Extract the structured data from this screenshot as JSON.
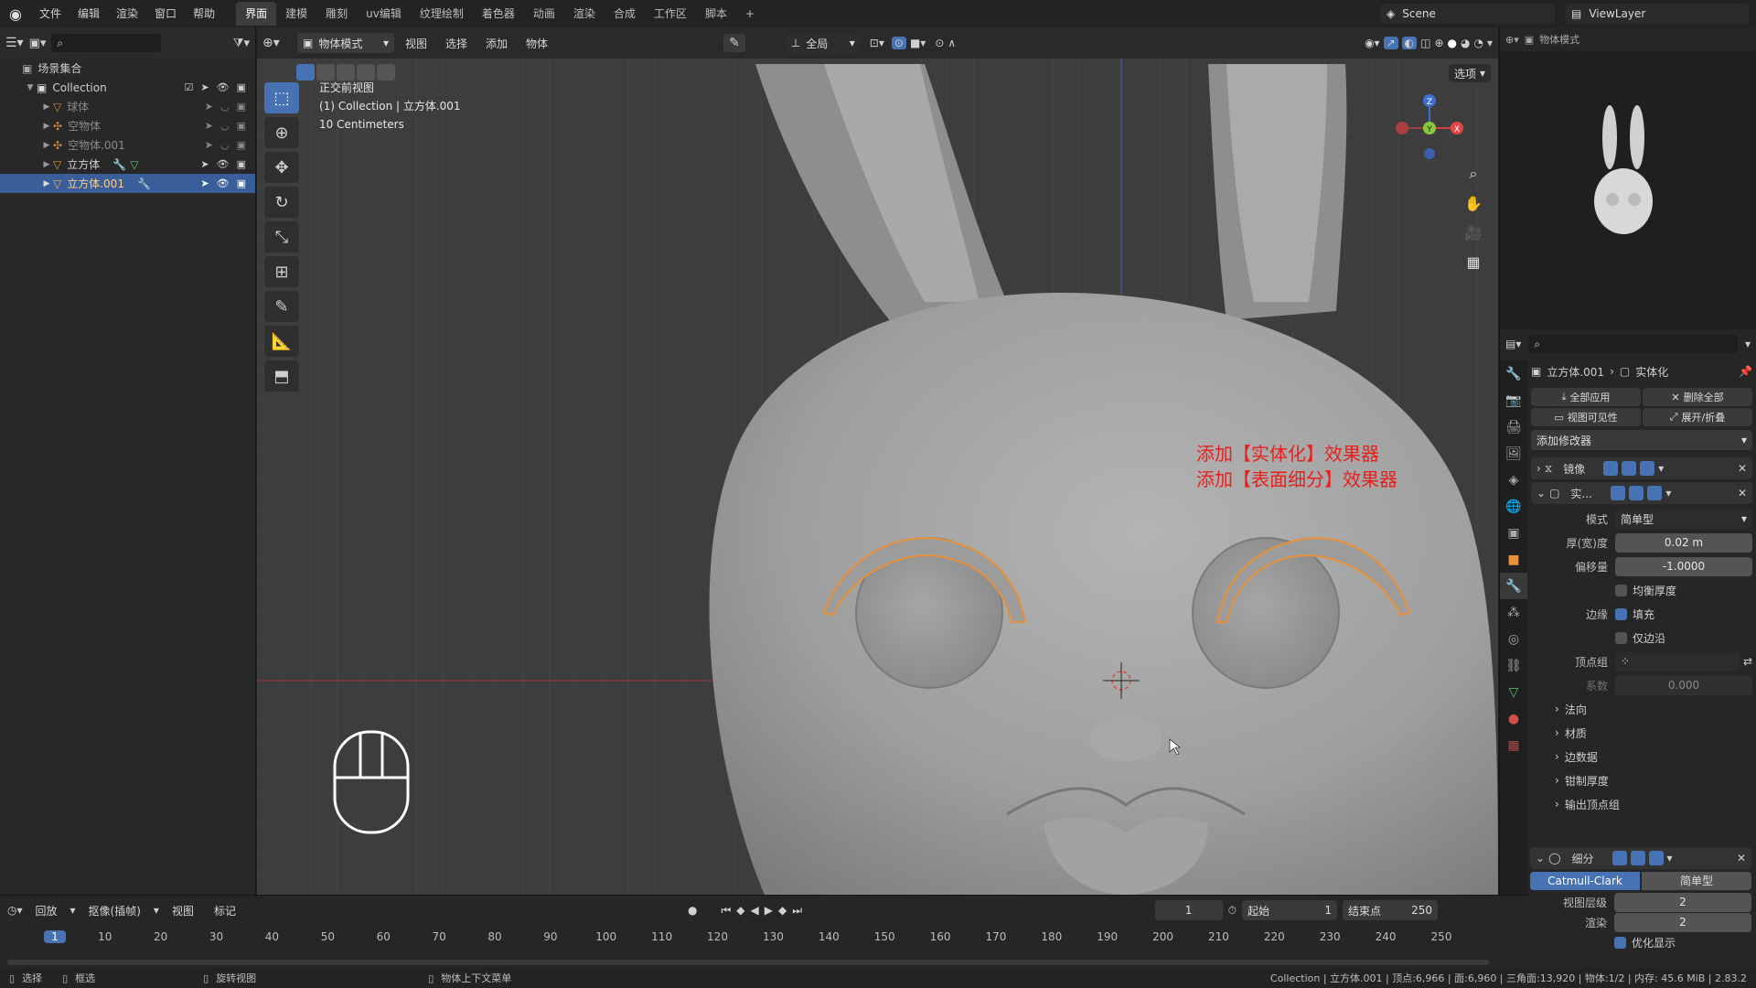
{
  "topbar": {
    "menus": [
      "文件",
      "编辑",
      "渲染",
      "窗口",
      "帮助"
    ],
    "workspaces": [
      "界面",
      "建模",
      "雕刻",
      "uv编辑",
      "纹理绘制",
      "着色器",
      "动画",
      "渲染",
      "合成",
      "工作区",
      "脚本"
    ],
    "active_workspace": "界面",
    "add_tab_icon": "plus-icon",
    "scene": "Scene",
    "viewlayer": "ViewLayer"
  },
  "outliner": {
    "scene_collection": "场景集合",
    "collection": "Collection",
    "items": [
      {
        "name": "球体",
        "active": false
      },
      {
        "name": "空物体",
        "active": false
      },
      {
        "name": "空物体.001",
        "active": false
      },
      {
        "name": "立方体",
        "active": false
      },
      {
        "name": "立方体.001",
        "active": true
      }
    ]
  },
  "viewport": {
    "mode": "物体模式",
    "menus": [
      "视图",
      "选择",
      "添加",
      "物体"
    ],
    "transform_orientation": "全局",
    "options_label": "选项",
    "info_line1": "正交前视图",
    "info_line2": "(1) Collection | 立方体.001",
    "info_line3": "10 Centimeters",
    "gizmo_axes": {
      "x": "X",
      "y": "Y",
      "z": "Z"
    },
    "annotation_line1": "添加【实体化】效果器",
    "annotation_line2": "添加【表面细分】效果器",
    "colors": {
      "annotation": "#e8201c",
      "selection_outline": "#e8913a",
      "model": "#9a9a9a"
    }
  },
  "properties": {
    "breadcrumb_object": "立方体.001",
    "breadcrumb_modifier": "实体化",
    "apply_all": "全部应用",
    "delete_all": "删除全部",
    "viewport_vis": "视图可见性",
    "expand_collapse": "展开/折叠",
    "add_modifier": "添加修改器",
    "modifiers": [
      {
        "name": "镜像",
        "collapsed": true
      },
      {
        "name": "实...",
        "collapsed": false
      },
      {
        "name": "细分",
        "collapsed": false
      }
    ],
    "solidify": {
      "mode_label": "模式",
      "mode_value": "简单型",
      "thickness_label": "厚(宽)度",
      "thickness_value": "0.02 m",
      "offset_label": "偏移量",
      "offset_value": "-1.0000",
      "even_thickness": "均衡厚度",
      "rim_label": "边缘",
      "rim_fill": "填充",
      "rim_only": "仅边沿",
      "vertex_group_label": "顶点组",
      "factor_label": "系数",
      "factor_value": "0.000",
      "subpanels": [
        "法向",
        "材质",
        "边数据",
        "钳制厚度",
        "输出顶点组"
      ]
    },
    "subsurf": {
      "type_catmull": "Catmull-Clark",
      "type_simple": "简单型",
      "viewport_levels_label": "视图层级",
      "viewport_levels_value": "2",
      "render_label": "渲染",
      "render_value": "2",
      "optimal_display": "优化显示"
    }
  },
  "timeline": {
    "menus": [
      "回放",
      "抠像(插帧)",
      "视图",
      "标记"
    ],
    "current_frame": "1",
    "start_label": "起始",
    "start_value": "1",
    "end_label": "结束点",
    "end_value": "250",
    "ticks": [
      "1",
      "10",
      "20",
      "30",
      "40",
      "50",
      "60",
      "70",
      "80",
      "90",
      "100",
      "110",
      "120",
      "130",
      "140",
      "150",
      "160",
      "170",
      "180",
      "190",
      "200",
      "210",
      "220",
      "230",
      "240",
      "250"
    ]
  },
  "statusbar": {
    "select": "选择",
    "box_select": "框选",
    "rotate_view": "旋转视图",
    "context_menu": "物体上下文菜单",
    "stats": "Collection | 立方体.001 | 顶点:6,966 | 面:6,960 | 三角面:13,920 | 物体:1/2 | 内存: 45.6 MiB | 2.83.2"
  }
}
